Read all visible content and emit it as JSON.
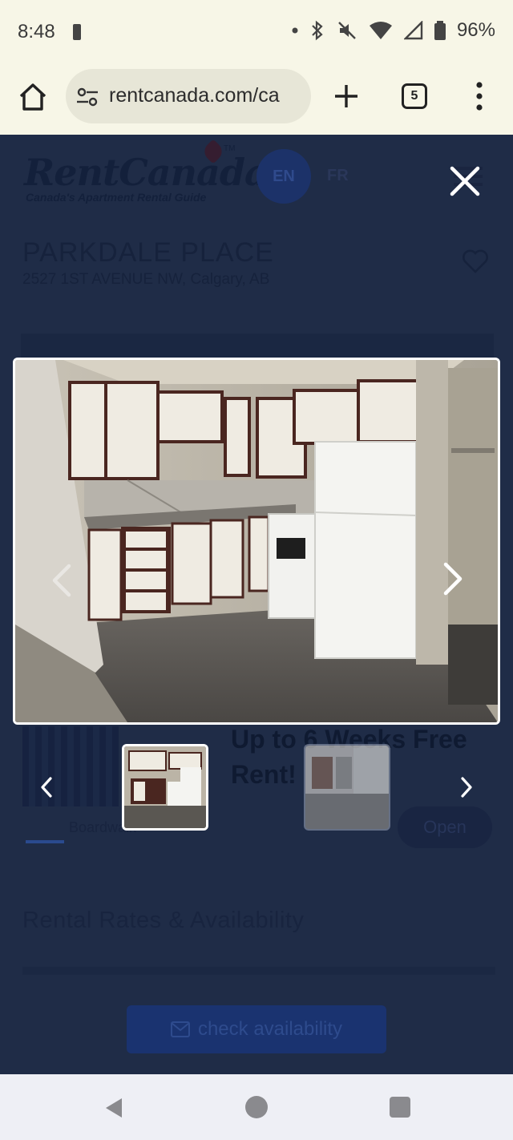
{
  "status_bar": {
    "time": "8:48",
    "battery_percent": "96%"
  },
  "browser": {
    "url": "rentcanada.com/ca",
    "tab_count": "5"
  },
  "site": {
    "logo": "RentCanada",
    "logo_trademark": "TM",
    "tagline": "Canada's Apartment Rental Guide",
    "lang_en": "EN",
    "lang_fr": "FR"
  },
  "property": {
    "name": "PARKDALE PLACE",
    "address": "2527 1ST AVENUE NW, Calgary, AB"
  },
  "promo": {
    "line1": "Up to 6 Weeks Free",
    "line2": "Rent!",
    "building_label": "Boardwalk",
    "open_label": "Open"
  },
  "rates": {
    "title": "Rental Rates & Availability"
  },
  "cta": {
    "check_availability": "check availability"
  },
  "gallery": {
    "active_index": 0,
    "thumbnails": [
      "kitchen",
      "living-room"
    ]
  },
  "colors": {
    "overlay_bg": "#1d2a44",
    "chrome_bg": "#f7f6e7",
    "accent_blue": "#1a3370"
  }
}
